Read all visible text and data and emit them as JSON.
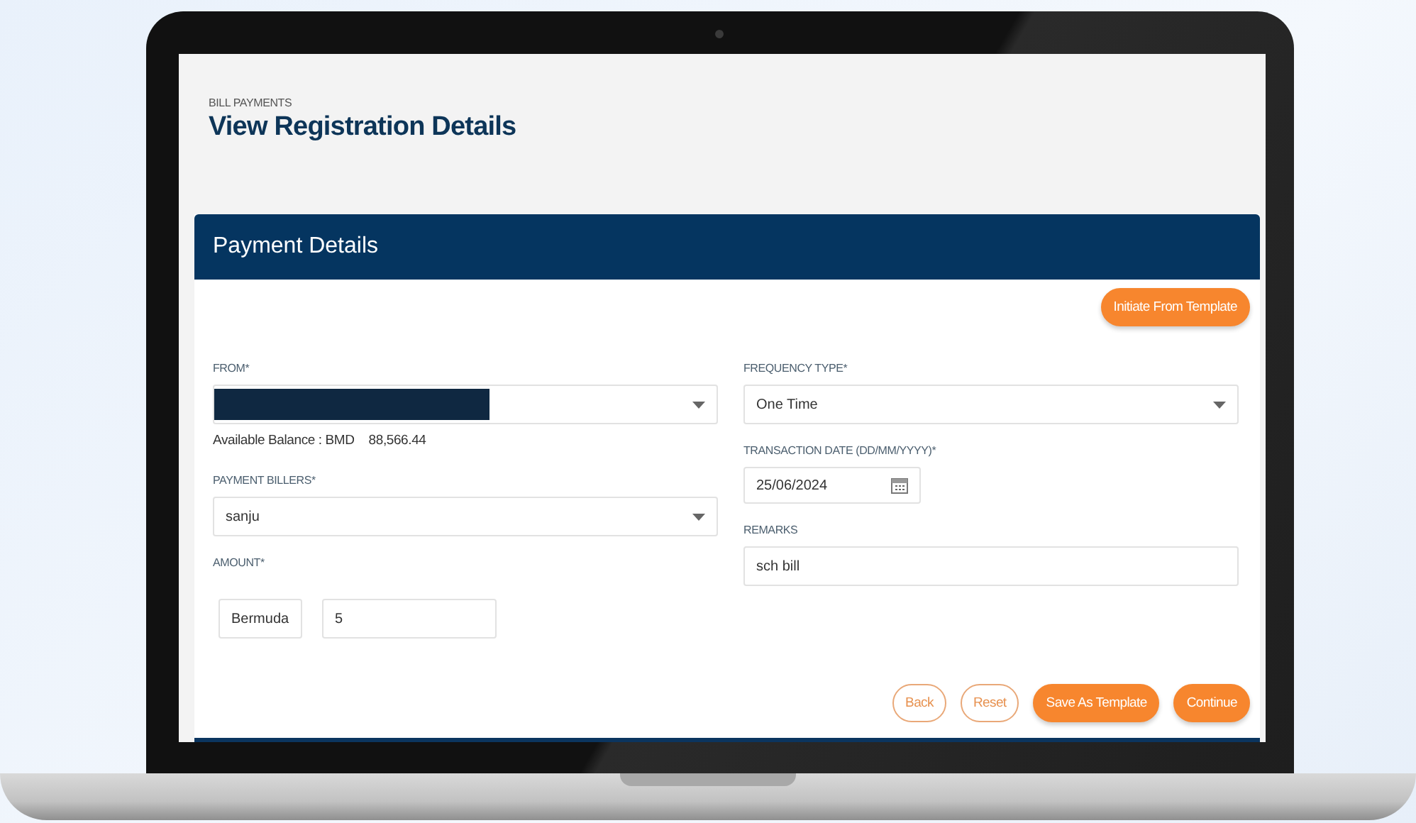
{
  "header": {
    "breadcrumb": "BILL PAYMENTS",
    "title": "View Registration Details"
  },
  "panel": {
    "title": "Payment Details",
    "template_button": "Initiate From Template",
    "left_fields": [
      {
        "kind": "select",
        "label": "FROM*",
        "redacted": true,
        "note": {
          "label": "Available Balance : BMD",
          "value": "88,566.44"
        }
      },
      {
        "kind": "select",
        "label": "PAYMENT BILLERS*",
        "value": "sanju"
      },
      {
        "kind": "amount",
        "label": "AMOUNT*",
        "currency": "Bermuda",
        "value": "5"
      }
    ],
    "right_fields": [
      {
        "kind": "select",
        "label": "FREQUENCY TYPE*",
        "value": "One Time"
      },
      {
        "kind": "date",
        "label": "TRANSACTION DATE (DD/MM/YYYY)*",
        "value": "25/06/2024"
      },
      {
        "kind": "text",
        "label": "REMARKS",
        "value": "sch bill"
      }
    ],
    "actions": [
      {
        "label": "Back",
        "kind": "outline"
      },
      {
        "label": "Reset",
        "kind": "outline"
      },
      {
        "label": "Save As Template",
        "kind": "filled"
      },
      {
        "label": "Continue",
        "kind": "filled"
      }
    ]
  }
}
